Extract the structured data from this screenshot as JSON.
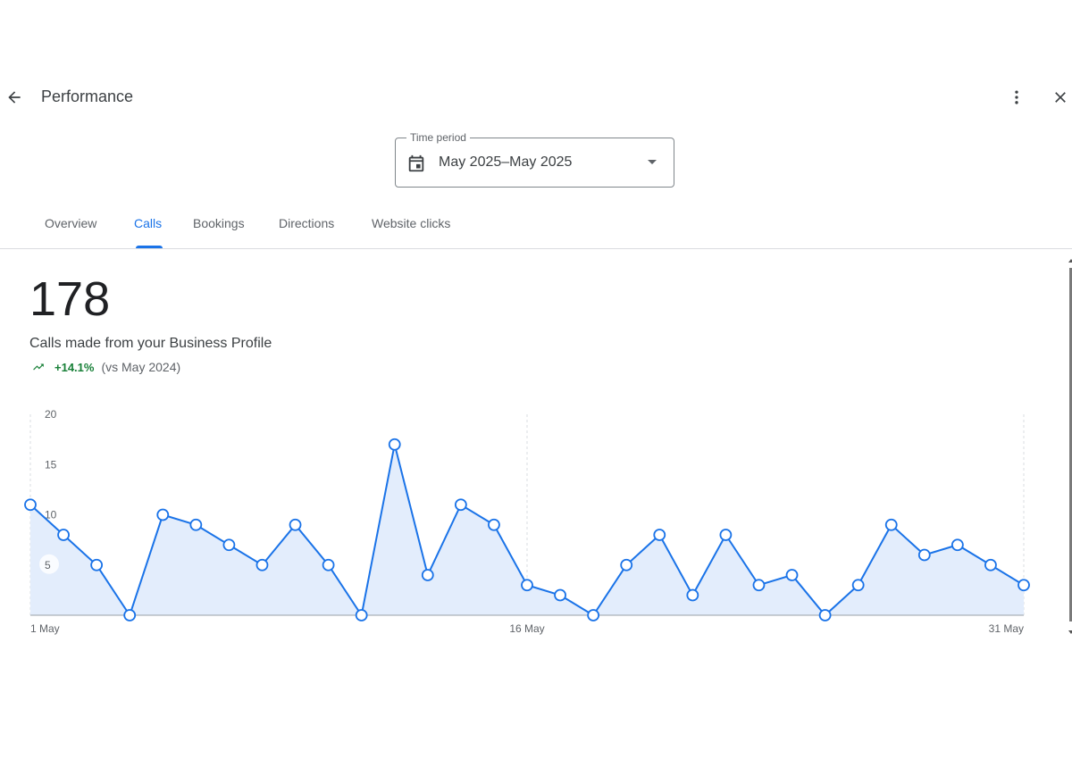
{
  "header": {
    "title": "Performance",
    "back_icon": "arrow-back-icon",
    "more_icon": "more-vert-icon",
    "close_icon": "close-icon"
  },
  "time_period": {
    "label": "Time period",
    "value": "May 2025–May 2025",
    "icon": "calendar-icon"
  },
  "tabs": [
    {
      "label": "Overview",
      "active": false
    },
    {
      "label": "Calls",
      "active": true
    },
    {
      "label": "Bookings",
      "active": false
    },
    {
      "label": "Directions",
      "active": false
    },
    {
      "label": "Website clicks",
      "active": false
    }
  ],
  "metric": {
    "value": "178",
    "label": "Calls made from your Business Profile",
    "change": "+14.1%",
    "comparison": "(vs May 2024)",
    "trend_icon": "trending-up-icon"
  },
  "colors": {
    "accent": "#1a73e8",
    "line": "#1a73e8",
    "area": "#e3edfc",
    "positive": "#188038"
  },
  "chart_data": {
    "type": "area",
    "x": [
      "1 May",
      "2 May",
      "3 May",
      "4 May",
      "5 May",
      "6 May",
      "7 May",
      "8 May",
      "9 May",
      "10 May",
      "11 May",
      "12 May",
      "13 May",
      "14 May",
      "15 May",
      "16 May",
      "17 May",
      "18 May",
      "19 May",
      "20 May",
      "21 May",
      "22 May",
      "23 May",
      "24 May",
      "25 May",
      "26 May",
      "27 May",
      "28 May",
      "29 May",
      "30 May",
      "31 May"
    ],
    "values": [
      11,
      8,
      5,
      0,
      10,
      9,
      7,
      5,
      9,
      5,
      0,
      17,
      4,
      11,
      9,
      3,
      2,
      0,
      5,
      8,
      2,
      8,
      3,
      4,
      0,
      3,
      9,
      6,
      7,
      5,
      3
    ],
    "x_tick_labels": [
      "1 May",
      "16 May",
      "31 May"
    ],
    "y_ticks": [
      5,
      10,
      15,
      20
    ],
    "ylim": [
      0,
      20
    ],
    "grid": "vertical dashed at labelled x ticks"
  }
}
